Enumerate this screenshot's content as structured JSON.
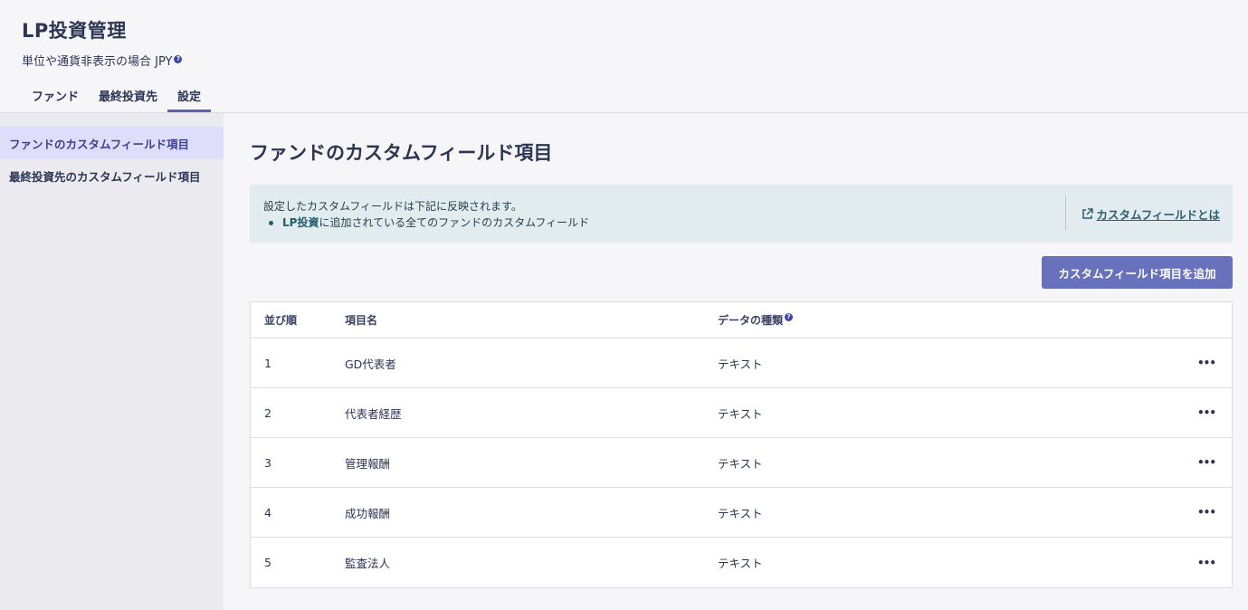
{
  "header": {
    "title": "LP投資管理",
    "subtitle": "単位や通貨非表示の場合 JPY",
    "tabs": [
      {
        "label": "ファンド",
        "active": false
      },
      {
        "label": "最終投資先",
        "active": false
      },
      {
        "label": "設定",
        "active": true
      }
    ]
  },
  "sidebar": {
    "items": [
      {
        "label": "ファンドのカスタムフィールド項目",
        "active": true
      },
      {
        "label": "最終投資先のカスタムフィールド項目",
        "active": false
      }
    ]
  },
  "main": {
    "title": "ファンドのカスタムフィールド項目",
    "info": {
      "text": "設定したカスタムフィールドは下記に反映されます。",
      "bullet_bold": "LP投資",
      "bullet_rest": "に追加されている全てのファンドのカスタムフィールド",
      "link_label": "カスタムフィールドとは"
    },
    "add_button_label": "カスタムフィールド項目を追加",
    "table": {
      "columns": [
        "並び順",
        "項目名",
        "データの種類"
      ],
      "rows": [
        {
          "order": "1",
          "name": "GD代表者",
          "type": "テキスト"
        },
        {
          "order": "2",
          "name": "代表者経歴",
          "type": "テキスト"
        },
        {
          "order": "3",
          "name": "管理報酬",
          "type": "テキスト"
        },
        {
          "order": "4",
          "name": "成功報酬",
          "type": "テキスト"
        },
        {
          "order": "5",
          "name": "監査法人",
          "type": "テキスト"
        }
      ],
      "row_menu_label": "•••"
    }
  },
  "colors": {
    "accent": "#5b62b6",
    "button": "#6871bb",
    "info_bg": "#e2ebee",
    "sidebar_active": "#dedefa"
  }
}
